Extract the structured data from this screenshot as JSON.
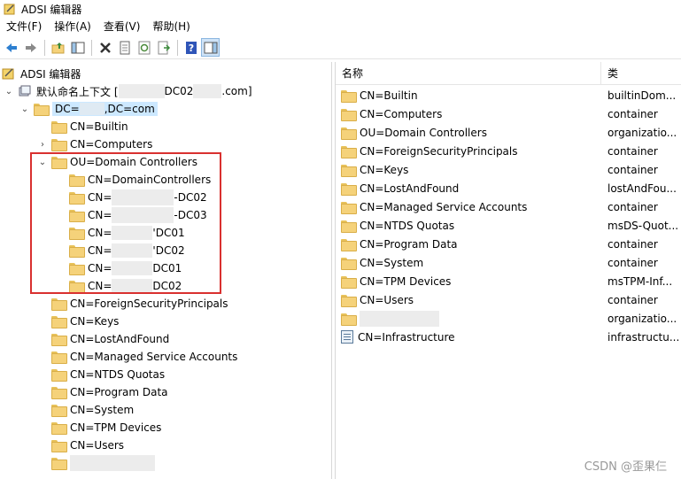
{
  "window": {
    "title": "ADSI 编辑器"
  },
  "menu": [
    "文件(F)",
    "操作(A)",
    "查看(V)",
    "帮助(H)"
  ],
  "toolbar_icons": [
    "back-arrow-icon",
    "forward-arrow-icon",
    "up-folder-icon",
    "show-hide-tree-icon",
    "delete-icon",
    "properties-icon",
    "refresh-icon",
    "export-list-icon",
    "help-icon",
    "show-hide-action-pane-icon"
  ],
  "tree": {
    "root": "ADSI 编辑器",
    "context_prefix": "默认命名上下文 [",
    "context_dc": "DC02",
    "context_suffix": ".com]",
    "dc_prefix": "DC=",
    "dc_suffix": ",DC=com",
    "builtin": "CN=Builtin",
    "computers": "CN=Computers",
    "ou_dc": "OU=Domain Controllers",
    "ou_children": [
      {
        "prefix": "CN=DomainControllers",
        "suffix": ""
      },
      {
        "prefix": "CN=",
        "suffix": "-DC02"
      },
      {
        "prefix": "CN=",
        "suffix": "-DC03"
      },
      {
        "prefix": "CN=",
        "suffix": "'DC01"
      },
      {
        "prefix": "CN=",
        "suffix": "'DC02"
      },
      {
        "prefix": "CN=",
        "suffix": "DC01"
      },
      {
        "prefix": "CN=",
        "suffix": "DC02"
      }
    ],
    "rest": [
      "CN=ForeignSecurityPrincipals",
      "CN=Keys",
      "CN=LostAndFound",
      "CN=Managed Service Accounts",
      "CN=NTDS Quotas",
      "CN=Program Data",
      "CN=System",
      "CN=TPM Devices",
      "CN=Users"
    ]
  },
  "list": {
    "header_name": "名称",
    "header_type": "类",
    "rows": [
      {
        "name": "CN=Builtin",
        "type": "builtinDom...",
        "icon": "folder-icon"
      },
      {
        "name": "CN=Computers",
        "type": "container",
        "icon": "computers-folder-icon"
      },
      {
        "name": "OU=Domain Controllers",
        "type": "organizatio...",
        "icon": "folder-icon"
      },
      {
        "name": "CN=ForeignSecurityPrincipals",
        "type": "container",
        "icon": "folder-icon"
      },
      {
        "name": "CN=Keys",
        "type": "container",
        "icon": "folder-icon"
      },
      {
        "name": "CN=LostAndFound",
        "type": "lostAndFou...",
        "icon": "folder-icon"
      },
      {
        "name": "CN=Managed Service Accounts",
        "type": "container",
        "icon": "folder-icon"
      },
      {
        "name": "CN=NTDS Quotas",
        "type": "msDS-Quot...",
        "icon": "folder-icon"
      },
      {
        "name": "CN=Program Data",
        "type": "container",
        "icon": "folder-icon"
      },
      {
        "name": "CN=System",
        "type": "container",
        "icon": "folder-icon"
      },
      {
        "name": "CN=TPM Devices",
        "type": "msTPM-Inf...",
        "icon": "folder-icon"
      },
      {
        "name": "CN=Users",
        "type": "container",
        "icon": "folder-icon"
      },
      {
        "name": "",
        "type": "organizatio...",
        "icon": "folder-icon"
      },
      {
        "name": "CN=Infrastructure",
        "type": "infrastructu...",
        "icon": "infrastructure-icon"
      }
    ]
  },
  "watermark": "CSDN @歪果仨"
}
